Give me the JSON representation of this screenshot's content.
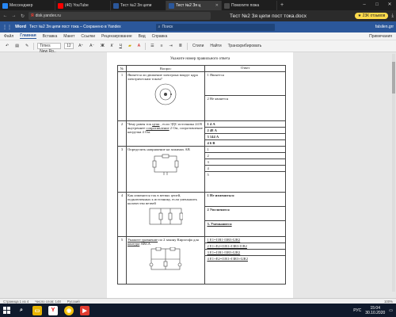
{
  "browser": {
    "tabs": [
      {
        "label": "Мессенджер",
        "color": "#2787f5",
        "active": false
      },
      {
        "label": "(40) YouTube",
        "color": "#ff0000",
        "active": false
      },
      {
        "label": "Тест №2 Зя цепи",
        "color": "#2b579a",
        "active": false
      },
      {
        "label": "Тест №2 Зя ц",
        "color": "#2b579a",
        "active": true
      },
      {
        "label": "Помогите пожа",
        "color": "#4a4a4a",
        "active": false
      }
    ],
    "url": "disk.yandex.ru",
    "page_title": "Тест №2 Зя цепи пост тока.docx",
    "review_badge": "★ 23К отзывов"
  },
  "word": {
    "app_name": "Word",
    "doc_title": "Тест №2 Зя цепи пост тока – Сохранено в Yandex",
    "search_placeholder": "Поиск",
    "user": "falsilen.grr",
    "ribbon_tabs": [
      "Файл",
      "Главная",
      "Вставка",
      "Макет",
      "Ссылки",
      "Рецензирование",
      "Вид",
      "Справка"
    ],
    "comments_label": "Примечания",
    "font_name": "Times New Ro..",
    "font_size": "12",
    "ribbon_items": {
      "styles": "Стили",
      "find": "Найти",
      "translate": "Транскрибировать"
    }
  },
  "document": {
    "title": "Укажите номер правильного ответа",
    "headers": {
      "num": "№",
      "question": "Вопрос",
      "answer": "Ответ"
    },
    "questions": [
      {
        "num": "1",
        "question": "Является ли движение электрона вокруг ядра электрическим током?",
        "options": [
          "1 Является",
          "2 Не является"
        ]
      },
      {
        "num": "2",
        "question_pre": "Чему равен ток ",
        "question_u1": "цепи",
        "question_mid": " , если ЭДС источника 24 В внутреннее ",
        "question_u2": "сопротивление",
        "question_post": " 2 Ом, сопротивление нагрузки 4 Ом.",
        "options": [
          "1 4 А",
          "2 48 А",
          "3 144 А",
          "4 6 В"
        ]
      },
      {
        "num": "3",
        "question": "Определить напряжение на зажимах АВ",
        "options": [
          "1",
          "2",
          "3",
          "4",
          "5"
        ]
      },
      {
        "num": "4",
        "question": "Как изменится ток в ветвях цепей, подключенных к источнику, если уменьшить количество ветвей",
        "options": [
          "1 Не изменяться",
          "2 Увеличится",
          "3. Уменьшится"
        ]
      },
      {
        "num": "5",
        "question_u": "Укажите уравнение",
        "question_rest": " по 2 закону Кирхгофа для ",
        "question_u2": "контура",
        "question_end": " АВСА",
        "options": [
          "1 E1=I1R1-I3R3-I2R2",
          "2 E1+E2=I1R1+I3R3-I1R2",
          "3 E1=I1R1-I3R3-I2R2",
          "4 E1+E2=I1R1+I3R3+I2R2"
        ]
      }
    ]
  },
  "status": {
    "left": "Страница 1 из 4",
    "words": "Число слов: 148",
    "lang": "Русский",
    "zoom": "100%"
  },
  "taskbar": {
    "lang": "РУС",
    "time": "15:04",
    "date": "30.10.2020"
  }
}
